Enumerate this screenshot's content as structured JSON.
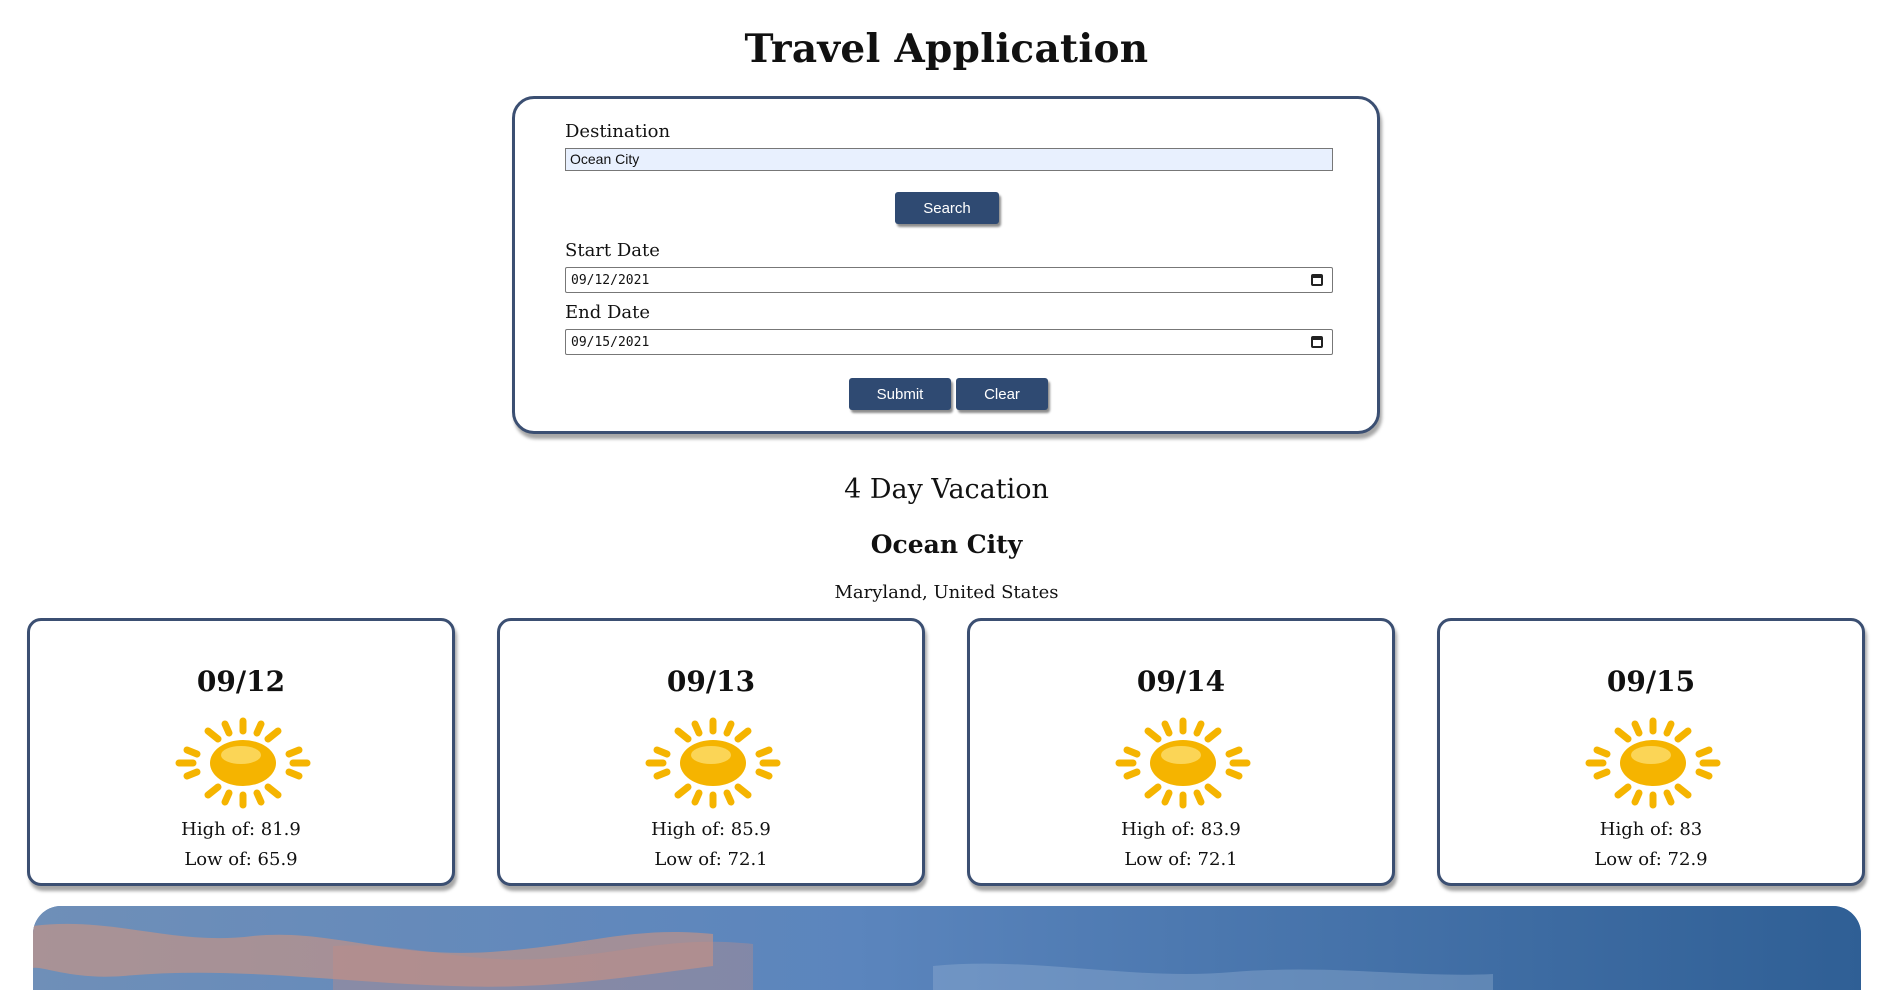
{
  "app": {
    "title": "Travel Application"
  },
  "form": {
    "destination_label": "Destination",
    "destination_value": "Ocean City",
    "search_label": "Search",
    "start_date_label": "Start Date",
    "start_date_value": "09/12/2021",
    "end_date_label": "End Date",
    "end_date_value": "09/15/2021",
    "submit_label": "Submit",
    "clear_label": "Clear"
  },
  "results": {
    "vacation_length": "4 Day Vacation",
    "city": "Ocean City",
    "region": "Maryland, United States",
    "days": [
      {
        "date": "09/12",
        "icon": "sun-icon",
        "high": "High of: 81.9",
        "low": "Low of: 65.9"
      },
      {
        "date": "09/13",
        "icon": "sun-icon",
        "high": "High of: 85.9",
        "low": "Low of: 72.1"
      },
      {
        "date": "09/14",
        "icon": "sun-icon",
        "high": "High of: 83.9",
        "low": "Low of: 72.1"
      },
      {
        "date": "09/15",
        "icon": "sun-icon",
        "high": "High of: 83",
        "low": "Low of: 72.9"
      }
    ]
  },
  "colors": {
    "accent": "#2f4a72",
    "card_border": "#3b4f72",
    "sun": "#f5b400",
    "autofill_bg": "#e8f0fe"
  }
}
